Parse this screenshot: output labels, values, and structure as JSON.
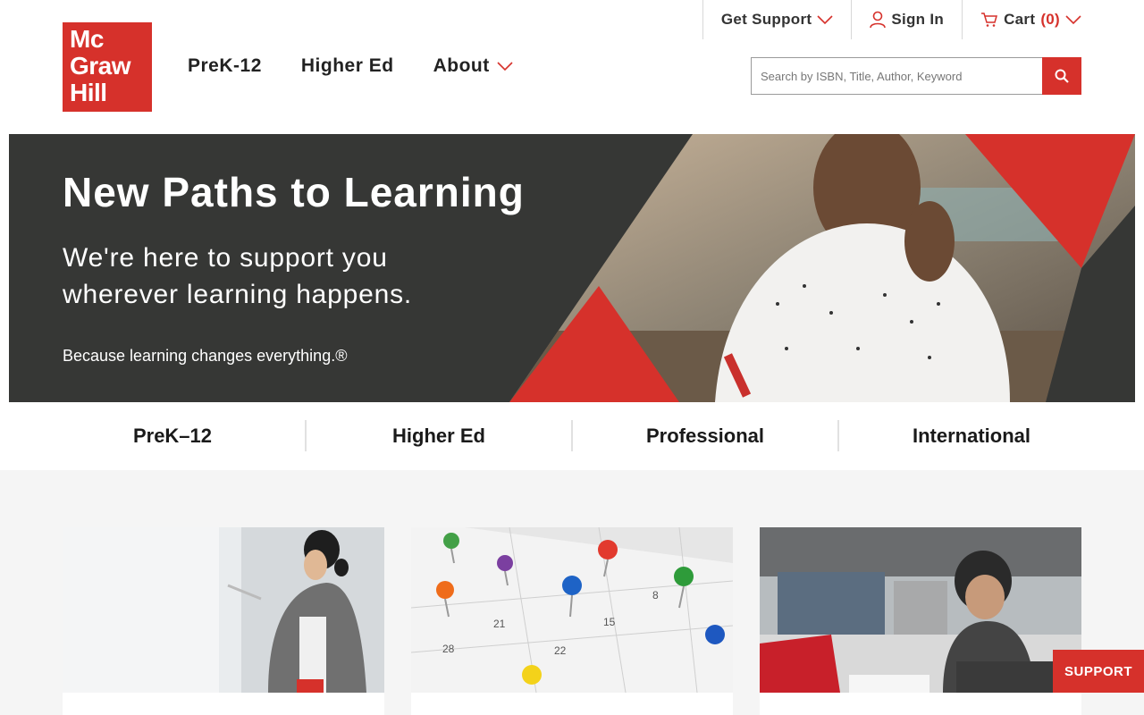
{
  "logo": {
    "lines": [
      "Mc",
      "Graw",
      "Hill"
    ],
    "brand_color": "#d6312b"
  },
  "main_nav": [
    {
      "label": "PreK-12"
    },
    {
      "label": "Higher Ed"
    },
    {
      "label": "About"
    }
  ],
  "utility_nav": {
    "support_label": "Get Support",
    "signin_label": "Sign In",
    "cart_label": "Cart",
    "cart_count": "(0)"
  },
  "search": {
    "placeholder": "Search by ISBN, Title, Author, Keyword",
    "icon": "search-icon"
  },
  "hero": {
    "title": "New Paths to Learning",
    "subtitle": "We're here to support you wherever learning happens.",
    "tagline": "Because learning changes everything.®",
    "background_color": "#363735"
  },
  "categories": [
    "PreK–12",
    "Higher Ed",
    "Professional",
    "International"
  ],
  "support_tab": {
    "label": "SUPPORT"
  }
}
